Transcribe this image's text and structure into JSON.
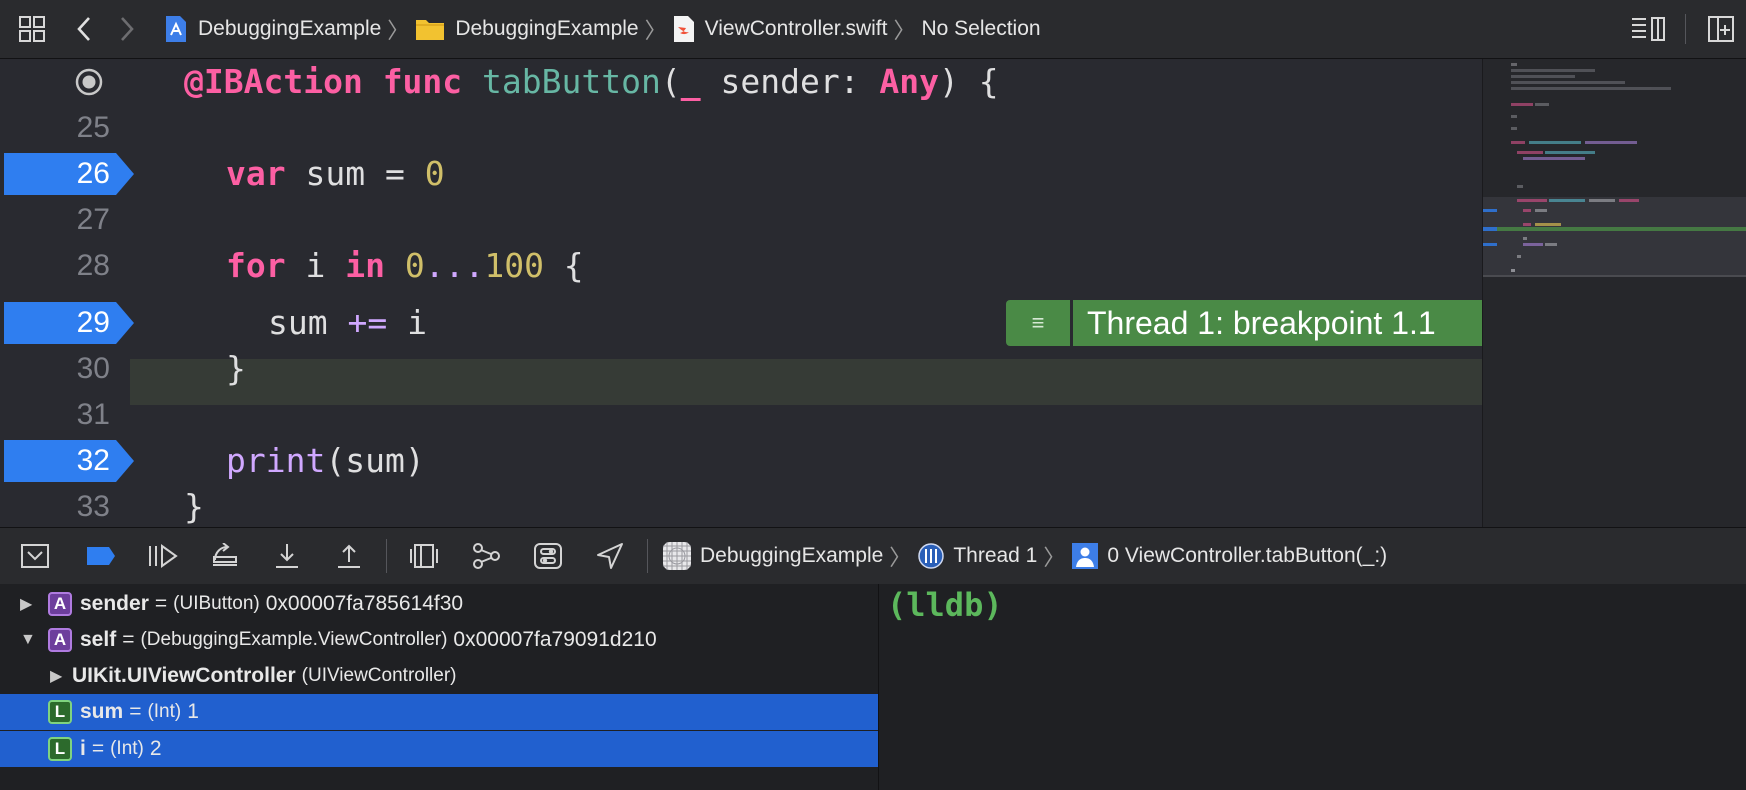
{
  "breadcrumb": {
    "project": "DebuggingExample",
    "group": "DebuggingExample",
    "file": "ViewController.swift",
    "selection": "No Selection"
  },
  "editor": {
    "lines": [
      {
        "num": "",
        "breakpoint": false
      },
      {
        "num": "25",
        "breakpoint": false
      },
      {
        "num": "26",
        "breakpoint": true
      },
      {
        "num": "27",
        "breakpoint": false
      },
      {
        "num": "28",
        "breakpoint": false
      },
      {
        "num": "29",
        "breakpoint": true
      },
      {
        "num": "30",
        "breakpoint": false
      },
      {
        "num": "31",
        "breakpoint": false
      },
      {
        "num": "32",
        "breakpoint": true
      },
      {
        "num": "33",
        "breakpoint": false
      }
    ],
    "code": {
      "l24_kw1": "@IBAction",
      "l24_kw2": "func",
      "l24_fn": "tabButton",
      "l24_open": "(",
      "l24_us": "_",
      "l24_param": " sender: ",
      "l24_type": "Any",
      "l24_close": ") {",
      "l26_kw": "var",
      "l26_rest": " sum = ",
      "l26_num": "0",
      "l28_kw1": "for",
      "l28_i": " i ",
      "l28_kw2": "in",
      "l28_n1": "0",
      "l28_op": "...",
      "l28_n2": "100",
      "l28_brace": " {",
      "l29_sum": "sum ",
      "l29_op": "+=",
      "l29_i": " i",
      "l30_brace": "}",
      "l32_fn": "print",
      "l32_rest": "(sum)",
      "l33_brace": "}"
    },
    "thread_banner": "Thread 1: breakpoint 1.1"
  },
  "debugbar": {
    "process": "DebuggingExample",
    "thread": "Thread 1",
    "frame": "0 ViewController.tabButton(_:)"
  },
  "variables": [
    {
      "expand": "collapsed",
      "kind": "A",
      "name": "sender",
      "eq": "=",
      "type": "(UIButton)",
      "value": "0x00007fa785614f30",
      "selected": false
    },
    {
      "expand": "expanded",
      "kind": "A",
      "name": "self",
      "eq": "=",
      "type": "(DebuggingExample.ViewController)",
      "value": "0x00007fa79091d210",
      "selected": false
    },
    {
      "expand": "collapsed",
      "kind": "",
      "name": "UIKit.UIViewController",
      "eq": "",
      "type": "(UIViewController)",
      "value": "",
      "selected": false
    },
    {
      "expand": "none",
      "kind": "L",
      "name": "sum",
      "eq": "=",
      "type": "(Int)",
      "value": "1",
      "selected": true
    },
    {
      "expand": "none",
      "kind": "L",
      "name": "i",
      "eq": "=",
      "type": "(Int)",
      "value": "2",
      "selected": true
    }
  ],
  "console": {
    "prompt": "(lldb)"
  },
  "colors": {
    "breakpoint": "#2f7ef0",
    "thread_banner": "#4a8a46",
    "selection": "#2160cf",
    "keyword": "#fc5fa3",
    "function": "#67b7a4",
    "number": "#d0bf69",
    "lldb_prompt": "#5cb85c"
  }
}
